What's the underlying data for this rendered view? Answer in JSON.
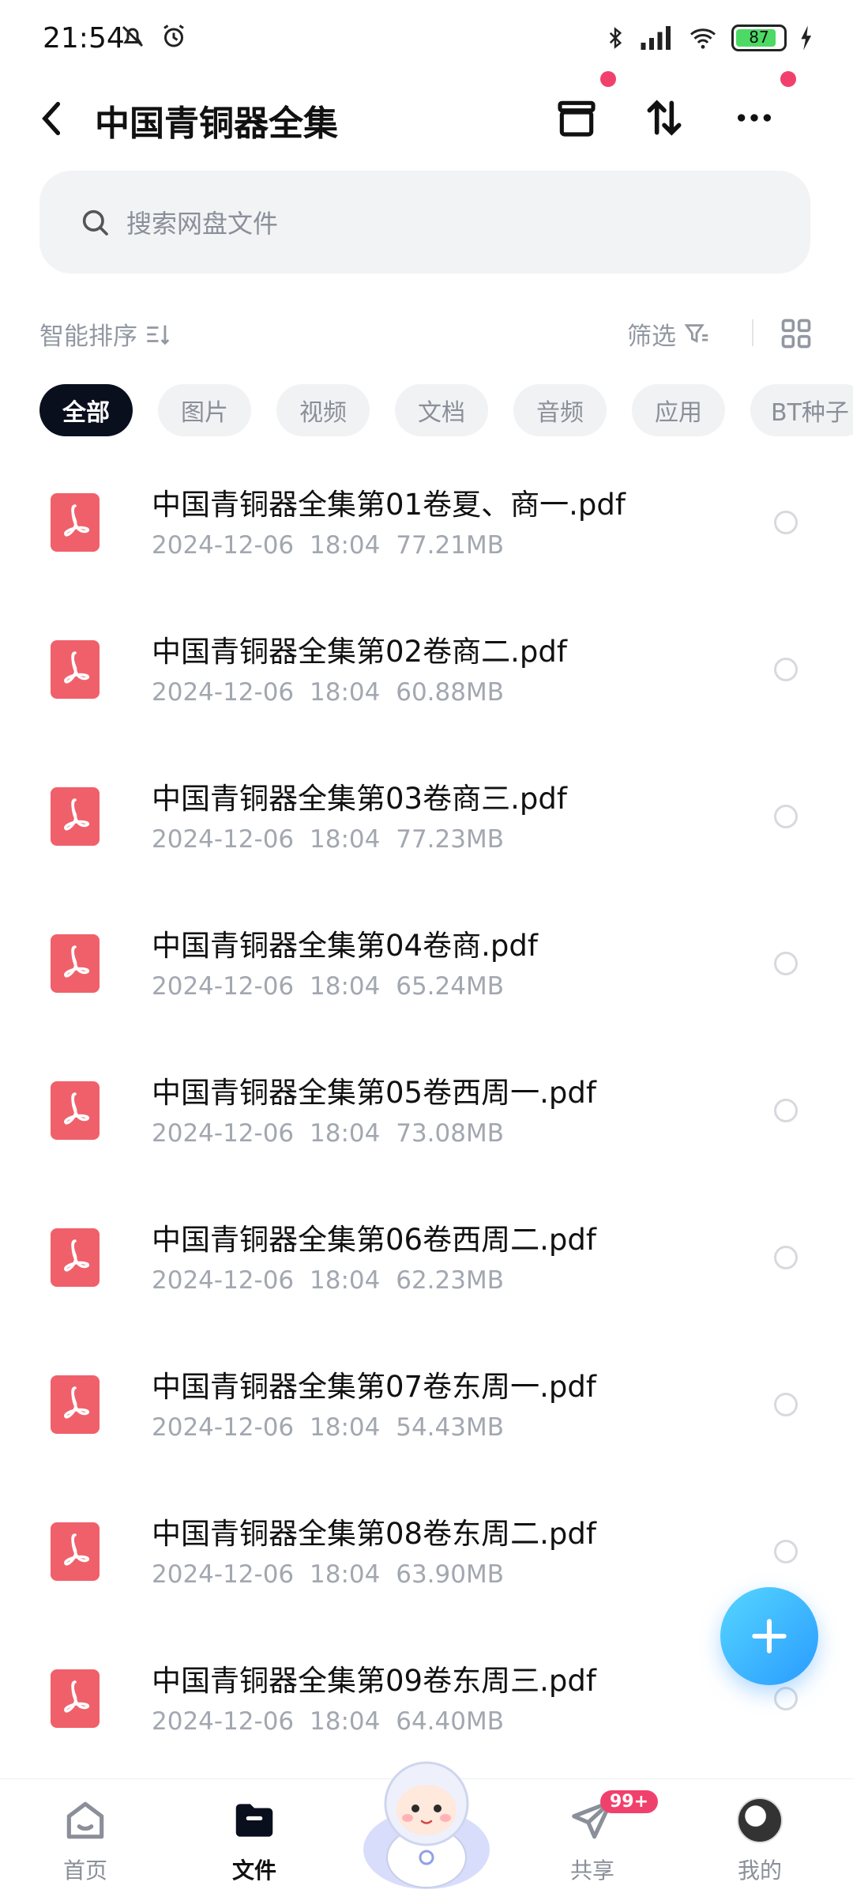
{
  "status_bar": {
    "time": "21:54",
    "battery": "87"
  },
  "header": {
    "title": "中国青铜器全集"
  },
  "search": {
    "placeholder": "搜索网盘文件"
  },
  "sort": {
    "label": "智能排序",
    "filter_label": "筛选"
  },
  "tabs": [
    {
      "label": "全部",
      "active": true
    },
    {
      "label": "图片"
    },
    {
      "label": "视频"
    },
    {
      "label": "文档"
    },
    {
      "label": "音频"
    },
    {
      "label": "应用"
    },
    {
      "label": "BT种子"
    }
  ],
  "files": [
    {
      "name": "中国青铜器全集第01卷夏、商一.pdf",
      "date": "2024-12-06",
      "time": "18:04",
      "size": "77.21MB"
    },
    {
      "name": "中国青铜器全集第02卷商二.pdf",
      "date": "2024-12-06",
      "time": "18:04",
      "size": "60.88MB"
    },
    {
      "name": "中国青铜器全集第03卷商三.pdf",
      "date": "2024-12-06",
      "time": "18:04",
      "size": "77.23MB"
    },
    {
      "name": "中国青铜器全集第04卷商.pdf",
      "date": "2024-12-06",
      "time": "18:04",
      "size": "65.24MB"
    },
    {
      "name": "中国青铜器全集第05卷西周一.pdf",
      "date": "2024-12-06",
      "time": "18:04",
      "size": "73.08MB"
    },
    {
      "name": "中国青铜器全集第06卷西周二.pdf",
      "date": "2024-12-06",
      "time": "18:04",
      "size": "62.23MB"
    },
    {
      "name": "中国青铜器全集第07卷东周一.pdf",
      "date": "2024-12-06",
      "time": "18:04",
      "size": "54.43MB"
    },
    {
      "name": "中国青铜器全集第08卷东周二.pdf",
      "date": "2024-12-06",
      "time": "18:04",
      "size": "63.90MB"
    },
    {
      "name": "中国青铜器全集第09卷东周三.pdf",
      "date": "2024-12-06",
      "time": "18:04",
      "size": "64.40MB"
    }
  ],
  "bottom_nav": {
    "home": "首页",
    "files": "文件",
    "share": "共享",
    "share_badge": "99+",
    "mine": "我的"
  },
  "colors": {
    "accent": "#2a9bff",
    "pdf": "#f0606a",
    "badge": "#f0416c"
  }
}
